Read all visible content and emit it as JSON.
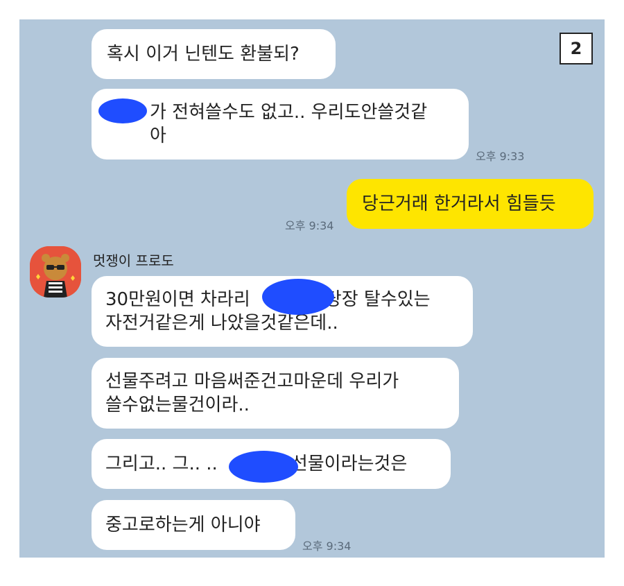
{
  "badge": "2",
  "sender_name": "멋쟁이 프로도",
  "messages": [
    {
      "text": "혹시 이거 닌텐도 환불되?"
    },
    {
      "text": "가 전혀쓸수도 없고.. 우리도안쓸것같\n아"
    },
    {
      "text": "당근거래 한거라서 힘들듯"
    },
    {
      "line1_a": "30만원이면 차라리",
      "line1_b": "당장 탈수있는",
      "line2": "자전거같은게 나았을것같은데.."
    },
    {
      "text": "선물주려고 마음써준건고마운데 우리가\n쓸수없는물건이라.."
    },
    {
      "part_a": "그리고.. 그.. ..",
      "part_b": "선물이라는것은"
    },
    {
      "text": "중고로하는게 아니야"
    }
  ],
  "times": {
    "t1": "오후 9:33",
    "t2": "오후 9:34",
    "t3": "오후 9:34"
  },
  "avatar": {
    "icon": "ryan-character-icon"
  },
  "colors": {
    "background": "#b2c7da",
    "mine": "#fee500",
    "theirs": "#ffffff",
    "redaction": "#1f4dff"
  }
}
